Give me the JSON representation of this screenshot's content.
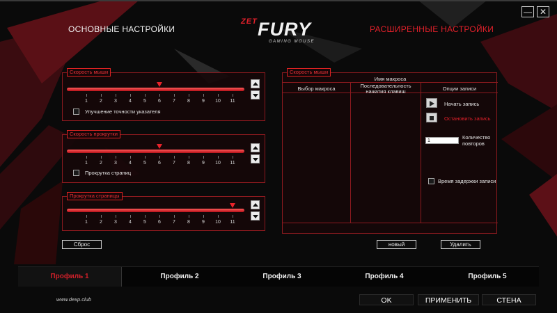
{
  "window": {
    "minimize_glyph": "—",
    "close_glyph": "✕"
  },
  "nav": {
    "main_settings": "ОСНОВНЫЕ НАСТРОЙКИ",
    "advanced_settings": "РАСШИРЕННЫЕ НАСТРОЙКИ"
  },
  "logo": {
    "brand": "ZET",
    "product": "FURY",
    "tagline": "GAMING MOUSE"
  },
  "colors": {
    "accent": "#e0202a",
    "panel_border": "#8c1a1f",
    "background": "#0a0a0a"
  },
  "mouse_speed": {
    "title": "Скорость мыши",
    "ticks": [
      "1",
      "2",
      "3",
      "4",
      "5",
      "6",
      "7",
      "8",
      "9",
      "10",
      "11"
    ],
    "value": 6,
    "checkbox_label": "Улучшение точности указателя",
    "checkbox_checked": false
  },
  "scroll_speed": {
    "title": "Скорость прокрутки",
    "ticks": [
      "1",
      "2",
      "3",
      "4",
      "5",
      "6",
      "7",
      "8",
      "9",
      "10",
      "11"
    ],
    "value": 6,
    "checkbox_label": "Прокрутка страниц",
    "checkbox_checked": false
  },
  "page_scroll": {
    "title": "Прокрутка страницы",
    "ticks": [
      "1",
      "2",
      "3",
      "4",
      "5",
      "6",
      "7",
      "8",
      "9",
      "10",
      "11"
    ],
    "value": 11
  },
  "buttons": {
    "reset": "Сброс",
    "new": "новый",
    "delete": "Удалить"
  },
  "macro": {
    "title": "Скорость мыши",
    "name_header": "Имя макроса",
    "col_select": "Выбор макроса",
    "col_sequence": "Последовательность нажатия клавиш",
    "col_options": "Опции записи",
    "start_record": "Начать запись",
    "stop_record": "Остановить запись",
    "repeat_label": "Количество повторов",
    "repeat_value": "1",
    "delay_label": "Время задержки записи",
    "delay_checked": false
  },
  "profiles": [
    {
      "label": "Профиль 1",
      "active": true
    },
    {
      "label": "Профиль 2",
      "active": false
    },
    {
      "label": "Профиль 3",
      "active": false
    },
    {
      "label": "Профиль 4",
      "active": false
    },
    {
      "label": "Профиль 5",
      "active": false
    }
  ],
  "footer": {
    "website": "www.dexp.club",
    "ok": "OK",
    "apply": "ПРИМЕНИТЬ",
    "cancel": "СТЕНА"
  }
}
